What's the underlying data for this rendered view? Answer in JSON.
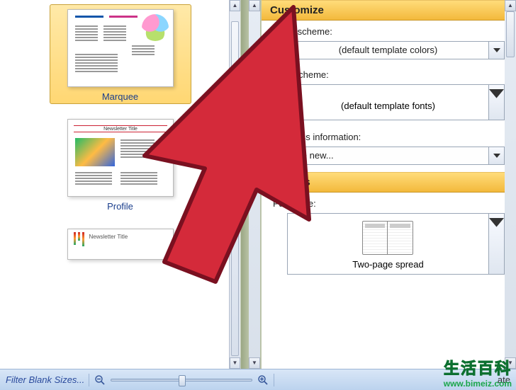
{
  "gallery": {
    "items": [
      {
        "label": "Marquee",
        "selected": true
      },
      {
        "label": "Profile",
        "selected": false
      },
      {
        "label": "Newsletter Title",
        "selected": false
      }
    ]
  },
  "panel": {
    "customize": {
      "header": "Customize",
      "color_scheme_label": "Color scheme:",
      "color_scheme_value": "(default template colors)",
      "font_scheme_label": "Font scheme:",
      "font_scheme_value": "(default template fonts)",
      "business_info_label": "Business information:",
      "business_info_value": "Create new..."
    },
    "options": {
      "header": "Options",
      "page_size_label": "Page size:",
      "page_size_value": "Two-page spread"
    }
  },
  "footer": {
    "filter_text": "Filter Blank Sizes...",
    "create_fragment": "ate"
  },
  "watermark": {
    "cn": "生活百科",
    "url": "www.bimeiz.com"
  }
}
